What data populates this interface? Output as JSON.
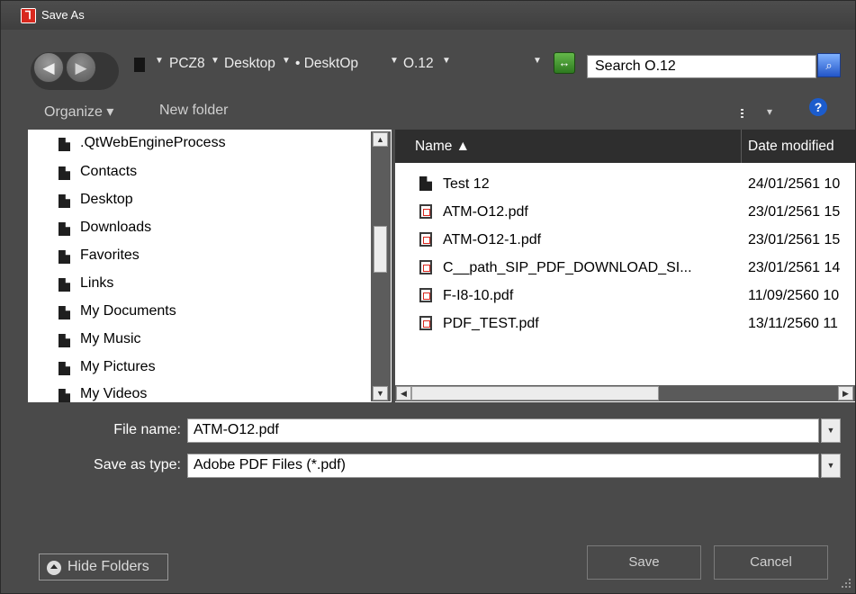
{
  "titlebar": {
    "title": "Save As",
    "app_icon_glyph": "⅂",
    "close_glyph": "✕"
  },
  "address": {
    "back_glyph": "◀",
    "forward_glyph": "▶",
    "crumbs": [
      "PCZ8",
      "Desktop",
      "• DesktOp",
      "O.12"
    ],
    "crumb_arrow_glyph": "▼",
    "refresh_glyph": "↔",
    "search_value": "Search O.12",
    "search_btn_glyph": "⌕"
  },
  "toolbar": {
    "organize_label": "Organize ▾",
    "new_folder_label": "New folder",
    "views_arrow": "▾",
    "help_glyph": "?"
  },
  "tree": {
    "items": [
      ".QtWebEngineProcess",
      "Contacts",
      "Desktop",
      "Downloads",
      "Favorites",
      "Links",
      "My Documents",
      "My Music",
      "My Pictures",
      "My Videos"
    ]
  },
  "file_list": {
    "header_name": "Name ▲",
    "header_date": "Date modified",
    "rows": [
      {
        "name": "Test 12",
        "date": "24/01/2561 10",
        "kind": "folder"
      },
      {
        "name": "ATM-O12.pdf",
        "date": "23/01/2561 15",
        "kind": "pdf"
      },
      {
        "name": "ATM-O12-1.pdf",
        "date": "23/01/2561 15",
        "kind": "pdf"
      },
      {
        "name": "C__path_SIP_PDF_DOWNLOAD_SI...",
        "date": "23/01/2561 14",
        "kind": "pdf"
      },
      {
        "name": "F-I8-10.pdf",
        "date": "11/09/2560 10",
        "kind": "pdf"
      },
      {
        "name": "PDF_TEST.pdf",
        "date": "13/11/2560 11",
        "kind": "pdf"
      }
    ]
  },
  "form": {
    "file_name_label": "File name:",
    "file_name_value": "ATM-O12.pdf",
    "save_type_label": "Save as type:",
    "save_type_value": "Adobe PDF Files (*.pdf)",
    "dropdown_glyph": "▼"
  },
  "buttons": {
    "hide_folders": "Hide Folders",
    "save": "Save",
    "cancel": "Cancel"
  },
  "colors": {
    "dialog_bg": "#4a4a4a",
    "pane_bg": "#ffffff",
    "header_bg": "#2e2e2e",
    "pdf_red": "#d8281e"
  }
}
